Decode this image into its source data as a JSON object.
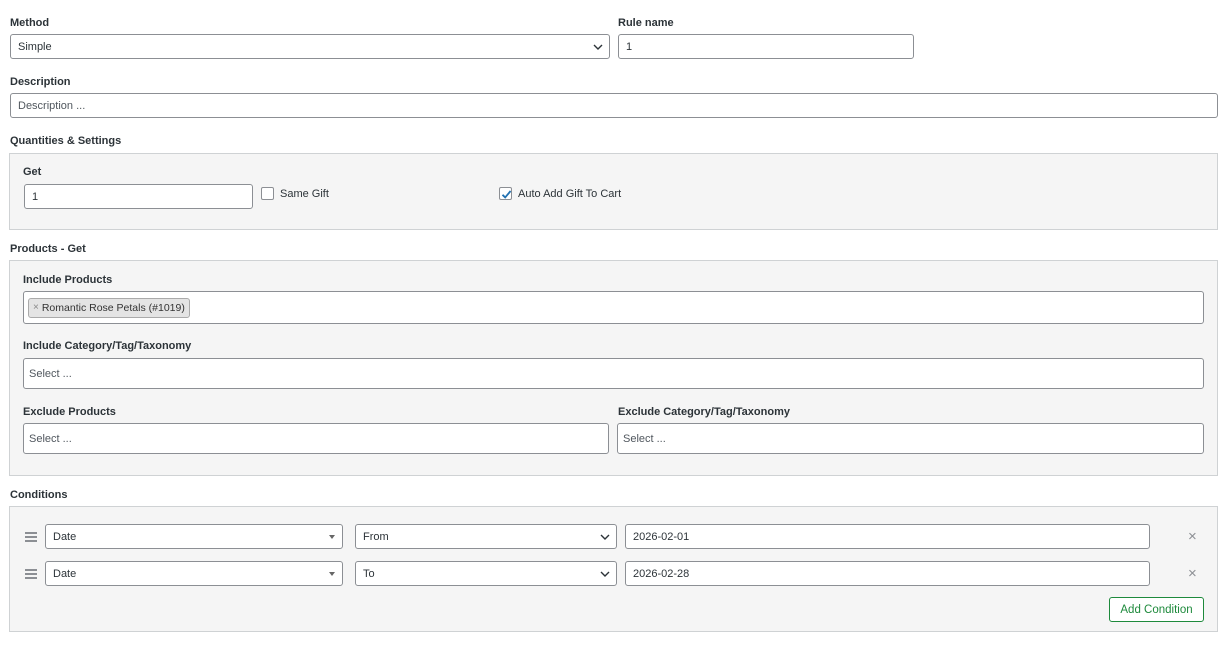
{
  "method": {
    "label": "Method",
    "value": "Simple"
  },
  "rule_name": {
    "label": "Rule name",
    "value": "1"
  },
  "description": {
    "label": "Description",
    "placeholder": "Description ..."
  },
  "quantities": {
    "label": "Quantities & Settings",
    "get_label": "Get",
    "get_value": "1",
    "same_gift_label": "Same Gift",
    "same_gift_checked": false,
    "auto_add_label": "Auto Add Gift To Cart",
    "auto_add_checked": true
  },
  "products_get": {
    "label": "Products - Get",
    "include_products_label": "Include Products",
    "include_products_tags": [
      {
        "remove": "×",
        "text": "Romantic Rose Petals (#1019)"
      }
    ],
    "include_category_label": "Include Category/Tag/Taxonomy",
    "include_category_placeholder": "Select ...",
    "exclude_products_label": "Exclude Products",
    "exclude_products_placeholder": "Select ...",
    "exclude_category_label": "Exclude Category/Tag/Taxonomy",
    "exclude_category_placeholder": "Select ..."
  },
  "conditions": {
    "label": "Conditions",
    "rows": [
      {
        "type": "Date",
        "operator": "From",
        "value": "2026-02-01"
      },
      {
        "type": "Date",
        "operator": "To",
        "value": "2026-02-28"
      }
    ],
    "remove_glyph": "×",
    "add_button": "Add Condition"
  },
  "colors": {
    "accent": "#2271b1",
    "add_button": "#1e8a3c",
    "panel_bg": "#f5f5f5"
  },
  "icons": {
    "select_arrow": "chevron-down-icon",
    "drag": "drag-handle-icon",
    "remove": "close-icon",
    "check": "checkmark-icon"
  }
}
